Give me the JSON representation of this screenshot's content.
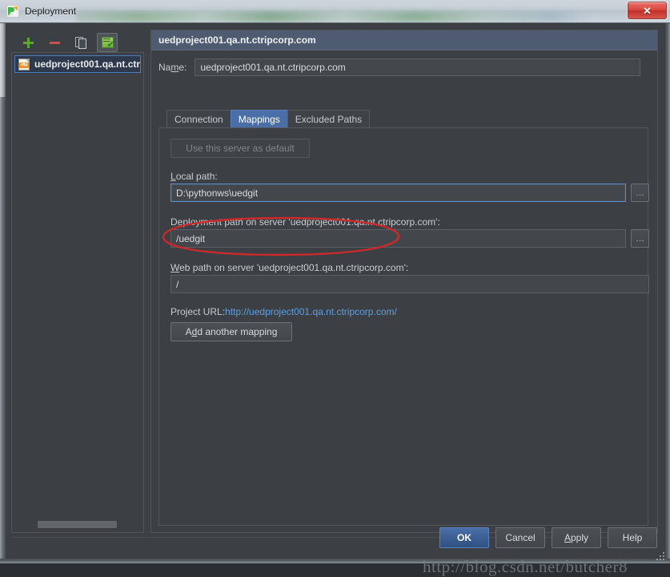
{
  "window": {
    "title": "Deployment",
    "app_icon": "pycharm-logo-icon",
    "close_label": "✕"
  },
  "sidebar": {
    "toolbar": [
      {
        "name": "add-server-button",
        "icon": "plus-icon",
        "label": "+"
      },
      {
        "name": "remove-server-button",
        "icon": "minus-icon",
        "label": "−"
      },
      {
        "name": "copy-server-button",
        "icon": "copy-icon",
        "label": ""
      },
      {
        "name": "use-as-default-button",
        "icon": "set-default-icon",
        "label": ""
      }
    ],
    "items": [
      {
        "label": "uedproject001.qa.nt.ctr",
        "icon_text": "sftp",
        "selected": true
      }
    ]
  },
  "panel": {
    "header_title": "uedproject001.qa.nt.ctripcorp.com",
    "name_label_pre": "Na",
    "name_label_mnemonic": "m",
    "name_label_post": "e:",
    "name_value": "uedproject001.qa.nt.ctripcorp.com",
    "tabs": [
      {
        "label": "Connection",
        "selected": false
      },
      {
        "label": "Mappings",
        "selected": true
      },
      {
        "label": "Excluded Paths",
        "selected": false
      }
    ]
  },
  "mappings": {
    "use_default_button": "Use this server as default",
    "local_path_label_mnemonic": "L",
    "local_path_label_rest": "ocal path:",
    "local_path_value": "D:\\pythonws\\uedgit",
    "deployment_path_label_pre": "D",
    "deployment_path_label_mnemonic": "e",
    "deployment_path_label_post": "ployment path on server 'uedproject001.qa.nt.ctripcorp.com':",
    "deployment_path_value": "/uedgit",
    "web_path_label_mnemonic": "W",
    "web_path_label_rest": "eb path on server 'uedproject001.qa.nt.ctripcorp.com':",
    "web_path_value": "/",
    "project_url_label": "Project URL:",
    "project_url_link": "http://uedproject001.qa.nt.ctripcorp.com/",
    "add_mapping_pre": "A",
    "add_mapping_mnemonic": "d",
    "add_mapping_post": "d another mapping",
    "browse_label": "…"
  },
  "buttons": [
    {
      "name": "ok-button",
      "label": "OK",
      "default": true
    },
    {
      "name": "cancel-button",
      "label": "Cancel",
      "default": false
    },
    {
      "name": "apply-button",
      "label": "Apply",
      "default": false
    },
    {
      "name": "help-button",
      "label": "Help",
      "default": false
    }
  ],
  "watermark": "http://blog.csdn.net/butcher8",
  "colors": {
    "panel_bg": "#3c4044",
    "accent_blue": "#4a6ea8",
    "header_bar": "#4f5b70",
    "link_blue": "#5d9fe0",
    "annotation_red": "#cc2a2a",
    "add_green": "#5aa832",
    "remove_red": "#c0564f"
  }
}
